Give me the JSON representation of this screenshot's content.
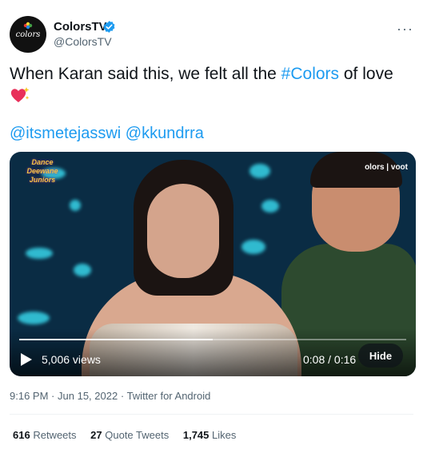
{
  "user": {
    "display_name": "ColorsTV",
    "handle": "@ColorsTV",
    "avatar_text": "colors",
    "verified_icon": "verified-badge-icon"
  },
  "more_icon": "···",
  "tweet": {
    "text_before": "When Karan said this, we felt all the ",
    "hashtag": "#Colors",
    "text_after": " of love",
    "emoji": "sparkling-heart-icon",
    "mentions": [
      "@itsmetejasswi",
      "@kkundrra"
    ]
  },
  "video": {
    "views": "5,006 views",
    "time": "0:08 / 0:16",
    "hide_label": "Hide",
    "show_logo": "Dance Deewane Juniors",
    "channel_logo": "olors | voot",
    "progress": 0.5
  },
  "meta": {
    "time": "9:16 PM",
    "date": "Jun 15, 2022",
    "source": "Twitter for Android"
  },
  "stats": {
    "retweets_count": "616",
    "retweets_label": "Retweets",
    "quotes_count": "27",
    "quotes_label": "Quote Tweets",
    "likes_count": "1,745",
    "likes_label": "Likes"
  },
  "colors": {
    "link": "#1d9bf0",
    "verified": "#1d9bf0",
    "secondary_text": "#536471"
  }
}
